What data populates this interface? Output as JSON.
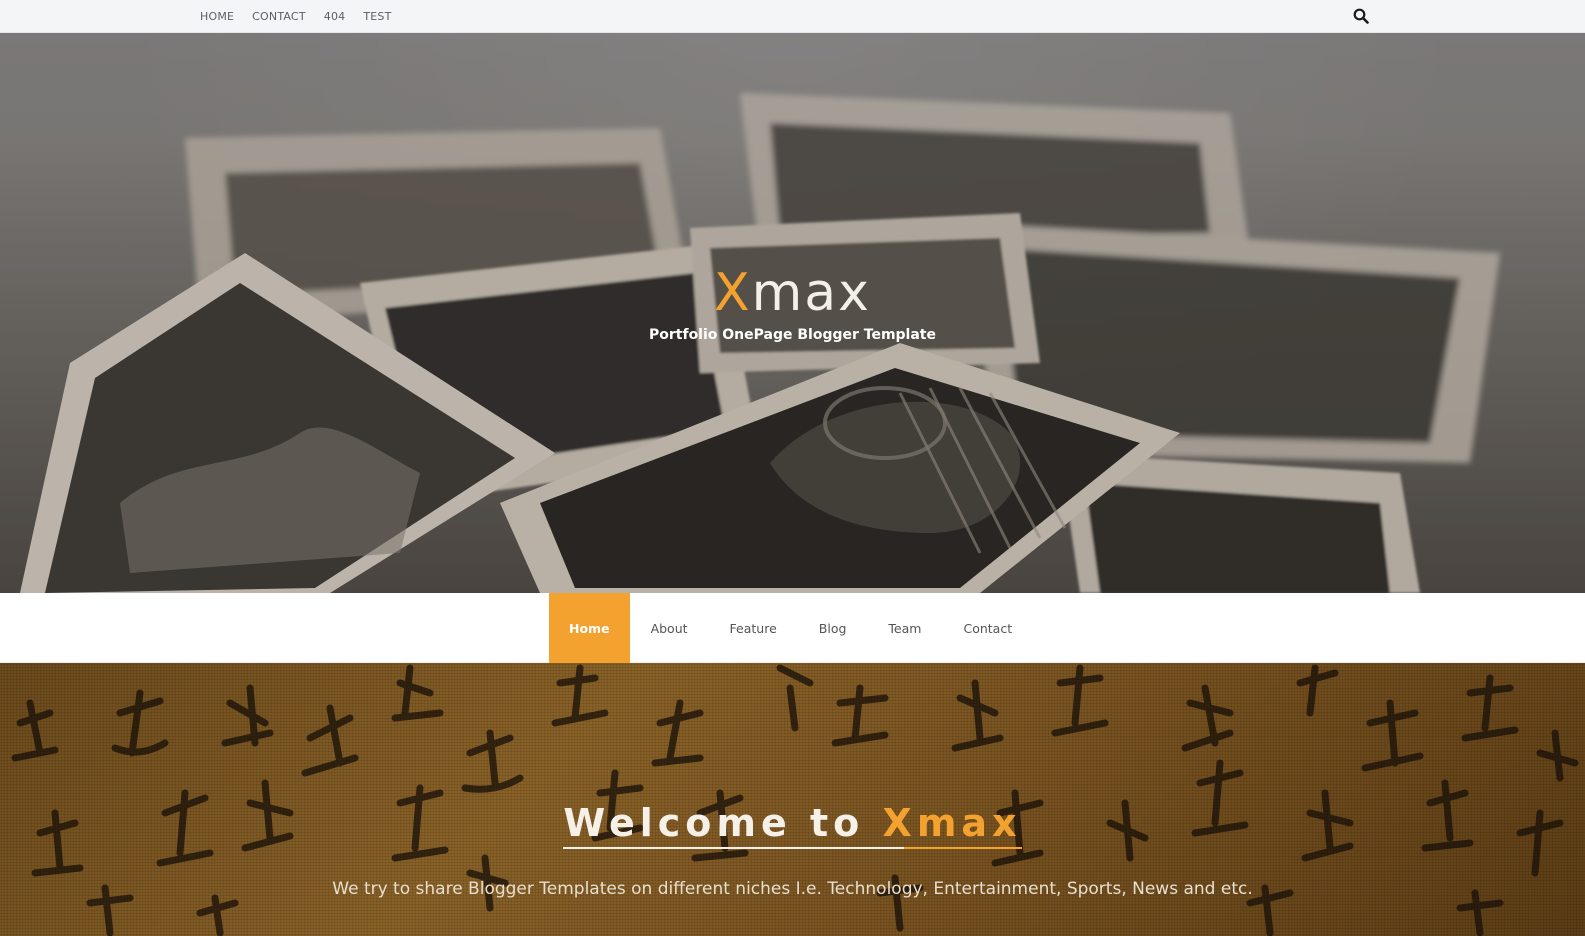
{
  "topbar": {
    "links": [
      "HOME",
      "CONTACT",
      "404",
      "TEST"
    ],
    "search_icon": "search-icon"
  },
  "hero": {
    "brand_accent": "X",
    "brand_rest": "max",
    "tagline": "Portfolio OnePage Blogger Template"
  },
  "mainnav": {
    "items": [
      "Home",
      "About",
      "Feature",
      "Blog",
      "Team",
      "Contact"
    ],
    "active": "Home"
  },
  "welcome": {
    "title_prefix": "Welcome to ",
    "title_accent": "Xmax",
    "text": "We try to share Blogger Templates on different niches I.e. Technology, Entertainment, Sports, News and etc."
  },
  "colors": {
    "accent": "#f3a230",
    "topbar_bg": "#f4f5f7",
    "nav_text": "#555555"
  }
}
